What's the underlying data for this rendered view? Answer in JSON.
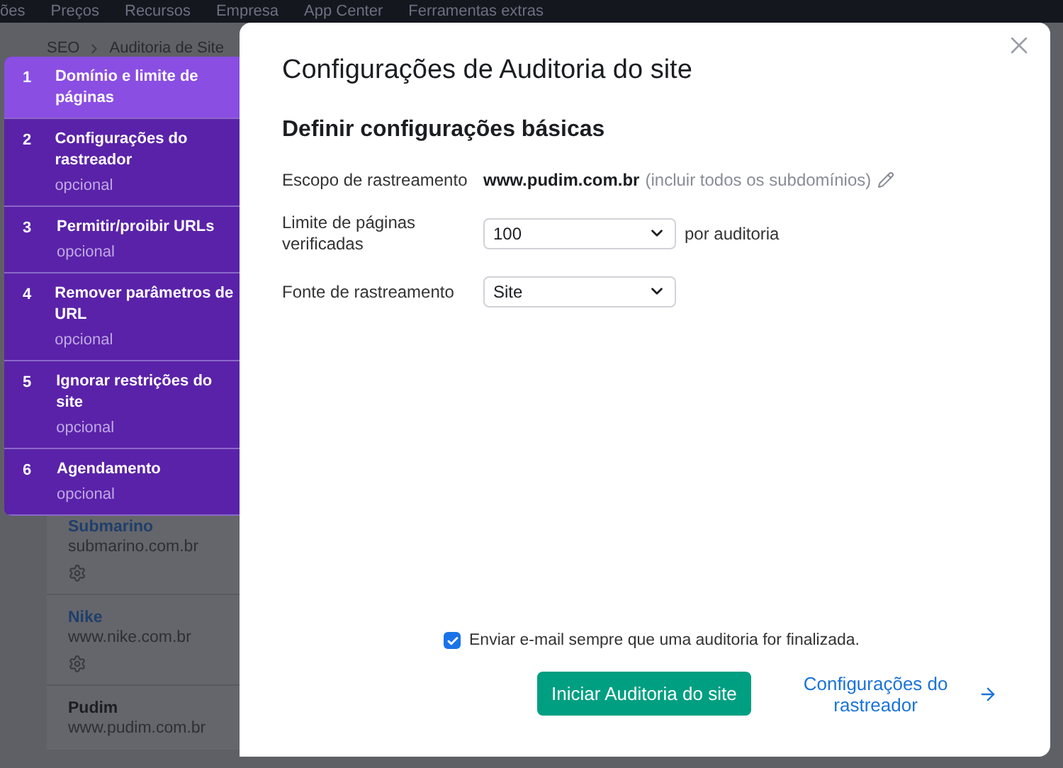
{
  "top_nav": [
    "ões",
    "Preços",
    "Recursos",
    "Empresa",
    "App Center",
    "Ferramentas extras"
  ],
  "breadcrumb": [
    "SEO",
    "Auditoria de Site"
  ],
  "projects": [
    {
      "name": "Submarino",
      "domain": "submarino.com.br",
      "linked": true,
      "settings": true
    },
    {
      "name": "Nike",
      "domain": "www.nike.com.br",
      "linked": true,
      "settings": true
    },
    {
      "name": "Pudim",
      "domain": "www.pudim.com.br",
      "linked": false,
      "settings": false
    }
  ],
  "steps": [
    {
      "number": "1",
      "title": "Domínio e limite de páginas",
      "selected": true
    },
    {
      "number": "2",
      "title": "Configurações do rastreador",
      "subtitle": "opcional",
      "selected": false
    },
    {
      "number": "3",
      "title": "Permitir/proibir URLs",
      "subtitle": "opcional",
      "selected": false
    },
    {
      "number": "4",
      "title": "Remover parâmetros de URL",
      "subtitle": "opcional",
      "selected": false
    },
    {
      "number": "5",
      "title": "Ignorar restrições do site",
      "subtitle": "opcional",
      "selected": false
    },
    {
      "number": "6",
      "title": "Agendamento",
      "subtitle": "opcional",
      "selected": false
    }
  ],
  "modal": {
    "title": "Configurações de Auditoria do site",
    "subtitle": "Definir configurações básicas",
    "scope": {
      "label": "Escopo de rastreamento",
      "domain": "www.pudim.com.br",
      "note": "(incluir todos os subdomínios)"
    },
    "page_limit": {
      "label": "Limite de páginas verificadas",
      "value": "100",
      "suffix": "por auditoria"
    },
    "source": {
      "label": "Fonte de rastreamento",
      "value": "Site"
    },
    "email": {
      "label": "Enviar e-mail sempre que uma auditoria for finalizada.",
      "checked": true
    },
    "start_button": "Iniciar Auditoria do site",
    "next_link": "Configurações do rastreador"
  }
}
